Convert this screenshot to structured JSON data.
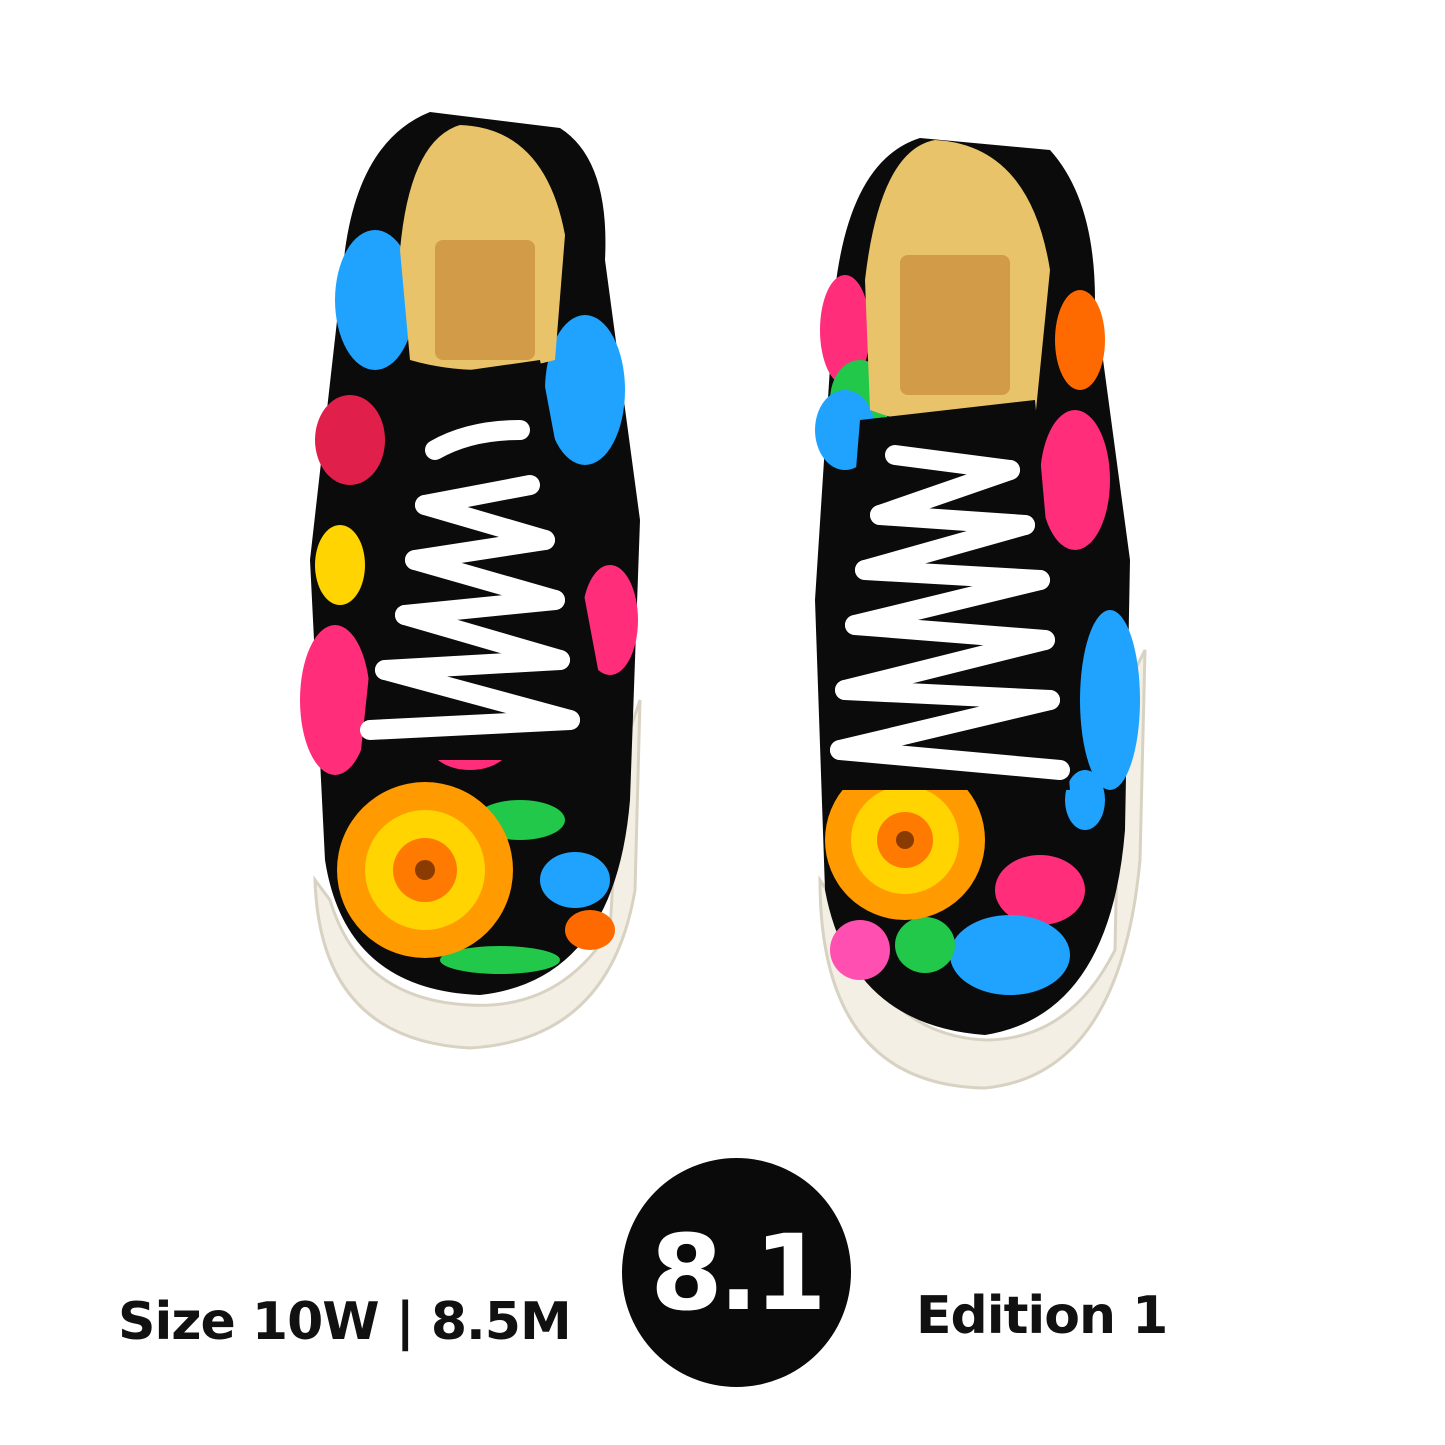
{
  "product": {
    "image_subject": "pair-of-embroidered-floral-sneakers",
    "size_label": "Size 10W | 8.5M",
    "grade_badge": "8.1",
    "edition_label": "Edition 1"
  },
  "colors": {
    "background": "#ffffff",
    "badge": "#0a0a0a",
    "badge_text": "#ffffff",
    "caption_text": "#111111",
    "shoe_base": "#0b0b0b",
    "sole": "#f3efe4",
    "lining": "#e8c36a",
    "laces": "#ffffff",
    "embroidery": [
      "#ff9a00",
      "#ffd400",
      "#ff2d7a",
      "#1fa3ff",
      "#22c84a",
      "#e0204a"
    ]
  }
}
